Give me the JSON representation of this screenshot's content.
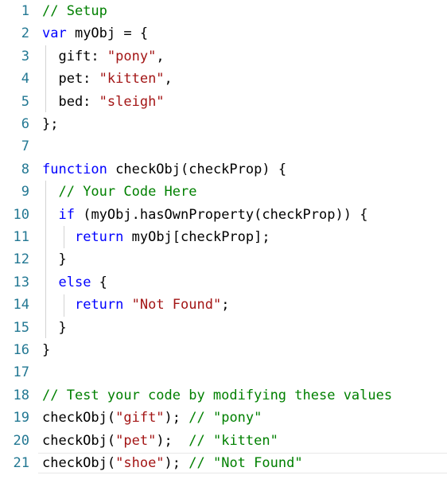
{
  "editor": {
    "colors": {
      "keyword": "#0000ff",
      "comment": "#008000",
      "string": "#a31515",
      "text": "#000000",
      "line_number": "#237893"
    },
    "lines": [
      {
        "number": "1",
        "tokens": [
          {
            "t": "comment",
            "v": "// Setup"
          }
        ]
      },
      {
        "number": "2",
        "tokens": [
          {
            "t": "keyword",
            "v": "var"
          },
          {
            "t": "text",
            "v": " myObj = {"
          }
        ]
      },
      {
        "number": "3",
        "tokens": [
          {
            "t": "text",
            "v": "  gift: "
          },
          {
            "t": "string",
            "v": "\"pony\""
          },
          {
            "t": "text",
            "v": ","
          }
        ]
      },
      {
        "number": "4",
        "tokens": [
          {
            "t": "text",
            "v": "  pet: "
          },
          {
            "t": "string",
            "v": "\"kitten\""
          },
          {
            "t": "text",
            "v": ","
          }
        ]
      },
      {
        "number": "5",
        "tokens": [
          {
            "t": "text",
            "v": "  bed: "
          },
          {
            "t": "string",
            "v": "\"sleigh\""
          }
        ]
      },
      {
        "number": "6",
        "tokens": [
          {
            "t": "text",
            "v": "};"
          }
        ]
      },
      {
        "number": "7",
        "tokens": []
      },
      {
        "number": "8",
        "tokens": [
          {
            "t": "keyword",
            "v": "function"
          },
          {
            "t": "text",
            "v": " checkObj(checkProp) {"
          }
        ]
      },
      {
        "number": "9",
        "tokens": [
          {
            "t": "text",
            "v": "  "
          },
          {
            "t": "comment",
            "v": "// Your Code Here"
          }
        ]
      },
      {
        "number": "10",
        "tokens": [
          {
            "t": "text",
            "v": "  "
          },
          {
            "t": "keyword",
            "v": "if"
          },
          {
            "t": "text",
            "v": " (myObj.hasOwnProperty(checkProp)) {"
          }
        ]
      },
      {
        "number": "11",
        "tokens": [
          {
            "t": "text",
            "v": "    "
          },
          {
            "t": "keyword",
            "v": "return"
          },
          {
            "t": "text",
            "v": " myObj[checkProp];"
          }
        ]
      },
      {
        "number": "12",
        "tokens": [
          {
            "t": "text",
            "v": "  }"
          }
        ]
      },
      {
        "number": "13",
        "tokens": [
          {
            "t": "text",
            "v": "  "
          },
          {
            "t": "keyword",
            "v": "else"
          },
          {
            "t": "text",
            "v": " {"
          }
        ]
      },
      {
        "number": "14",
        "tokens": [
          {
            "t": "text",
            "v": "    "
          },
          {
            "t": "keyword",
            "v": "return"
          },
          {
            "t": "text",
            "v": " "
          },
          {
            "t": "string",
            "v": "\"Not Found\""
          },
          {
            "t": "text",
            "v": ";"
          }
        ]
      },
      {
        "number": "15",
        "tokens": [
          {
            "t": "text",
            "v": "  }"
          }
        ]
      },
      {
        "number": "16",
        "tokens": [
          {
            "t": "text",
            "v": "}"
          }
        ]
      },
      {
        "number": "17",
        "tokens": []
      },
      {
        "number": "18",
        "tokens": [
          {
            "t": "comment",
            "v": "// Test your code by modifying these values"
          }
        ]
      },
      {
        "number": "19",
        "tokens": [
          {
            "t": "text",
            "v": "checkObj("
          },
          {
            "t": "string",
            "v": "\"gift\""
          },
          {
            "t": "text",
            "v": "); "
          },
          {
            "t": "comment",
            "v": "// \"pony\""
          }
        ]
      },
      {
        "number": "20",
        "tokens": [
          {
            "t": "text",
            "v": "checkObj("
          },
          {
            "t": "string",
            "v": "\"pet\""
          },
          {
            "t": "text",
            "v": ");  "
          },
          {
            "t": "comment",
            "v": "// \"kitten\""
          }
        ]
      },
      {
        "number": "21",
        "tokens": [
          {
            "t": "text",
            "v": "checkObj("
          },
          {
            "t": "string",
            "v": "\"shoe\""
          },
          {
            "t": "text",
            "v": "); "
          },
          {
            "t": "comment",
            "v": "// \"Not Found\""
          }
        ]
      }
    ]
  }
}
